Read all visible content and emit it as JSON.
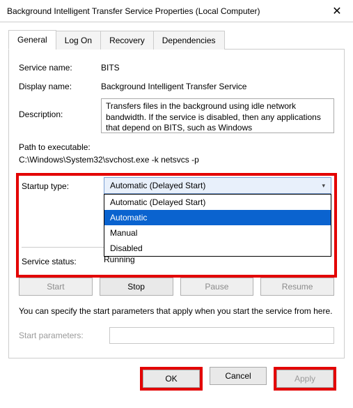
{
  "window": {
    "title": "Background Intelligent Transfer Service Properties (Local Computer)",
    "close_glyph": "✕"
  },
  "tabs": {
    "general": "General",
    "logon": "Log On",
    "recovery": "Recovery",
    "dependencies": "Dependencies"
  },
  "fields": {
    "service_name_label": "Service name:",
    "service_name": "BITS",
    "display_name_label": "Display name:",
    "display_name": "Background Intelligent Transfer Service",
    "description_label": "Description:",
    "description": "Transfers files in the background using idle network bandwidth. If the service is disabled, then any applications that depend on BITS, such as Windows",
    "path_label": "Path to executable:",
    "path_value": "C:\\Windows\\System32\\svchost.exe -k netsvcs -p",
    "startup_label": "Startup type:",
    "startup_selected": "Automatic (Delayed Start)",
    "startup_options": {
      "o1": "Automatic (Delayed Start)",
      "o2": "Automatic",
      "o3": "Manual",
      "o4": "Disabled"
    },
    "status_label": "Service status:",
    "status_value": "Running",
    "hint": "You can specify the start parameters that apply when you start the service from here.",
    "param_label": "Start parameters:"
  },
  "svc_buttons": {
    "start": "Start",
    "stop": "Stop",
    "pause": "Pause",
    "resume": "Resume"
  },
  "footer": {
    "ok": "OK",
    "cancel": "Cancel",
    "apply": "Apply"
  }
}
